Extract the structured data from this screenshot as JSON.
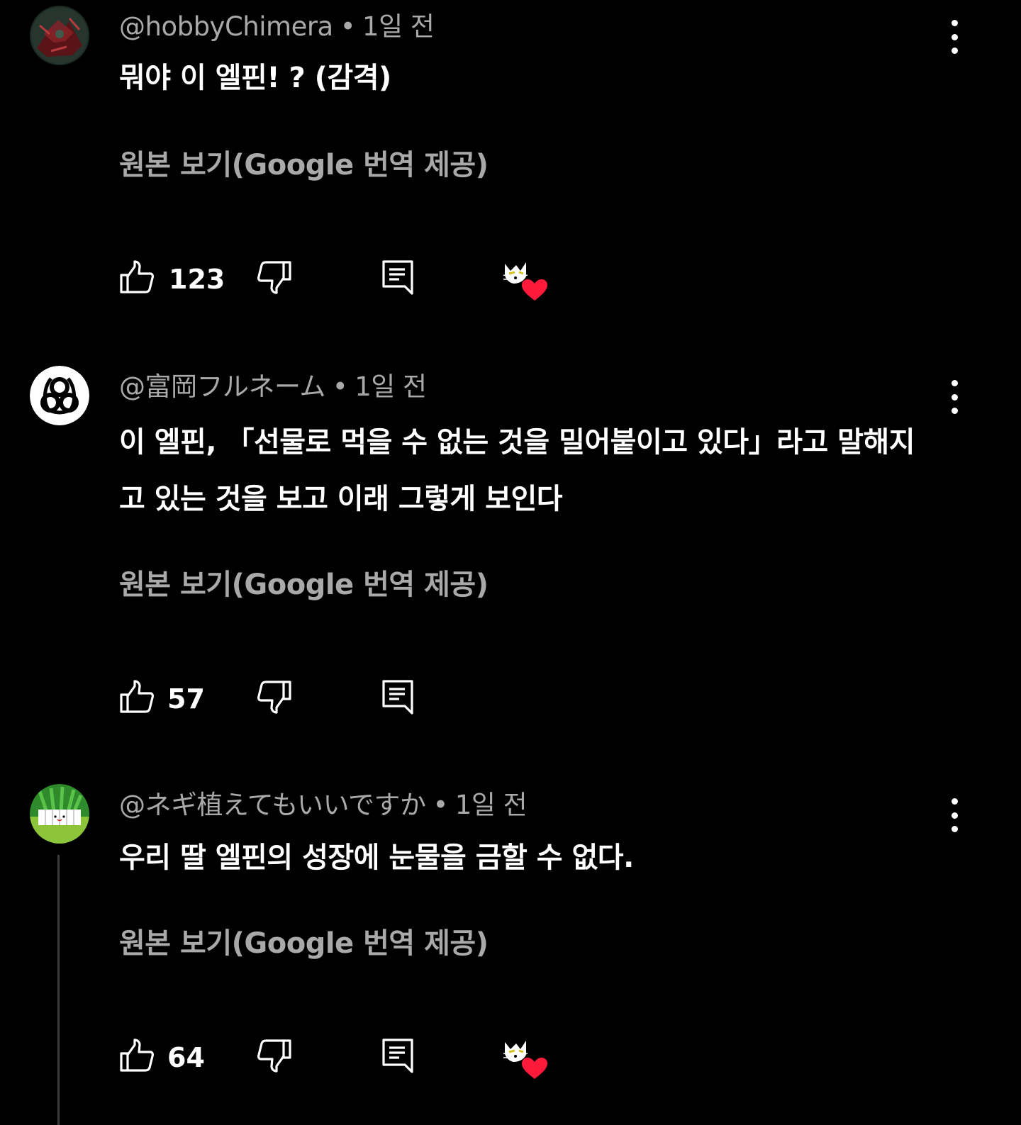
{
  "colors": {
    "background": "#000000",
    "text_primary": "#ffffff",
    "text_secondary": "#a9a9a9",
    "heart": "#ff1a3c"
  },
  "icons": {
    "like": "thumbs-up-icon",
    "dislike": "thumbs-down-icon",
    "reply": "reply-icon",
    "more": "more-vertical-icon",
    "creator_heart": "creator-heart-icon"
  },
  "comments": [
    {
      "author": "@hobbyChimera",
      "time": "1일 전",
      "text": "뭐야 이 엘핀! ? (감격)",
      "translate_label": "원본 보기(Google 번역 제공)",
      "likes": "123",
      "hearted": true
    },
    {
      "author": "@富岡フルネーム",
      "time": "1일 전",
      "text": "이 엘핀, 「선물로 먹을 수 없는 것을 밀어붙이고 있다」라고 말해지고 있는 것을 보고 이래 그렇게 보인다",
      "translate_label": "원본 보기(Google 번역 제공)",
      "likes": "57",
      "hearted": false
    },
    {
      "author": "@ネギ植えてもいいですか",
      "time": "1일 전",
      "text": "우리 딸 엘핀의 성장에 눈물을 금할 수 없다.",
      "translate_label": "원본 보기(Google 번역 제공)",
      "likes": "64",
      "hearted": true
    }
  ]
}
